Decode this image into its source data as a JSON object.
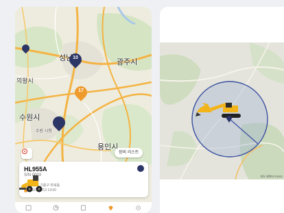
{
  "map_left": {
    "places": {
      "city_top": "성남시",
      "gwangju": "광주시",
      "uiwang": "의왕시",
      "suwon": "수원시",
      "suwon_sub": "수원 시청",
      "yongin": "용인시"
    },
    "pins": [
      {
        "label": "10",
        "color": "navy"
      },
      {
        "label": "17",
        "color": "orange"
      },
      {
        "label": "",
        "color": "navy"
      },
      {
        "label": "",
        "color": "navy"
      }
    ],
    "list_button": "장비 리스트"
  },
  "card": {
    "model": "HL955A",
    "serial": "S/N 0003",
    "address": "용인시 기흥구 마북동",
    "datetime": "2021/04/13 19:00"
  },
  "tabbar": {
    "items": [
      {
        "icon": "report-icon",
        "active": false
      },
      {
        "icon": "chart-icon",
        "active": false
      },
      {
        "icon": "document-icon",
        "active": false
      },
      {
        "icon": "location-pin-icon",
        "active": true
      },
      {
        "icon": "gear-icon",
        "active": false
      }
    ]
  },
  "map_right": {
    "copyright": "지도 데이터 ©2021"
  },
  "colors": {
    "navy": "#2b3566",
    "orange": "#ef9a2c",
    "road": "#f4b342",
    "geofence_fill": "#9bb0d4",
    "geofence_stroke": "#3a4fa0"
  }
}
